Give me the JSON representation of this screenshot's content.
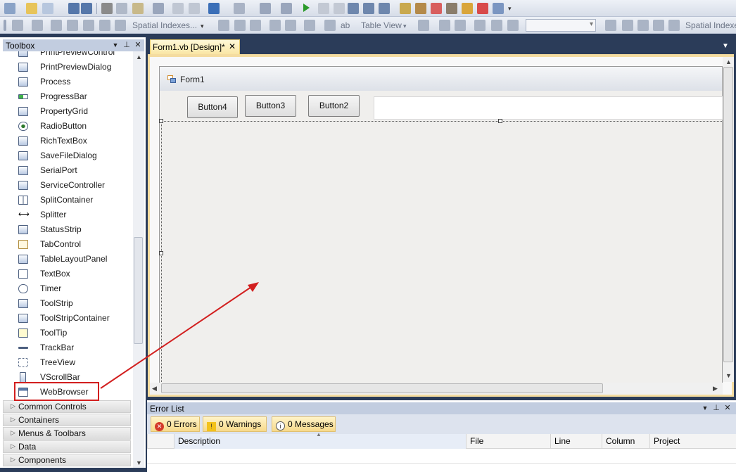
{
  "toolbar2": {
    "spatial_indexes_1": "Spatial Indexes...",
    "table_view": "Table View",
    "spatial_indexes_2": "Spatial Indexes"
  },
  "toolbox": {
    "title": "Toolbox",
    "items": [
      {
        "label": "PrintPreviewControl"
      },
      {
        "label": "PrintPreviewDialog"
      },
      {
        "label": "Process"
      },
      {
        "label": "ProgressBar"
      },
      {
        "label": "PropertyGrid"
      },
      {
        "label": "RadioButton"
      },
      {
        "label": "RichTextBox"
      },
      {
        "label": "SaveFileDialog"
      },
      {
        "label": "SerialPort"
      },
      {
        "label": "ServiceController"
      },
      {
        "label": "SplitContainer"
      },
      {
        "label": "Splitter"
      },
      {
        "label": "StatusStrip"
      },
      {
        "label": "TabControl"
      },
      {
        "label": "TableLayoutPanel"
      },
      {
        "label": "TextBox"
      },
      {
        "label": "Timer"
      },
      {
        "label": "ToolStrip"
      },
      {
        "label": "ToolStripContainer"
      },
      {
        "label": "ToolTip"
      },
      {
        "label": "TrackBar"
      },
      {
        "label": "TreeView"
      },
      {
        "label": "VScrollBar"
      },
      {
        "label": "WebBrowser"
      }
    ],
    "categories": [
      {
        "label": "Common Controls"
      },
      {
        "label": "Containers"
      },
      {
        "label": "Menus & Toolbars"
      },
      {
        "label": "Data"
      },
      {
        "label": "Components"
      }
    ]
  },
  "document": {
    "tab_label": "Form1.vb [Design]*",
    "form_title": "Form1",
    "buttons": [
      {
        "label": "Button4"
      },
      {
        "label": "Button3"
      },
      {
        "label": "Button2"
      }
    ]
  },
  "error_list": {
    "title": "Error List",
    "errors_label": "0 Errors",
    "warnings_label": "0 Warnings",
    "messages_label": "0 Messages",
    "columns": [
      "Description",
      "File",
      "Line",
      "Column",
      "Project"
    ]
  },
  "colors": {
    "accent_highlight": "#d21f1f",
    "ide_background": "#2b3c59",
    "tab_active": "#f9e5a2"
  }
}
